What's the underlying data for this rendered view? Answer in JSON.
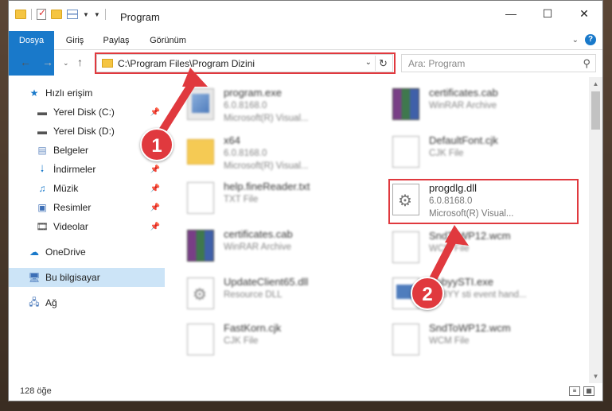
{
  "window": {
    "title": "Program"
  },
  "ribbon": {
    "tabs": [
      "Dosya",
      "Giriş",
      "Paylaş",
      "Görünüm"
    ]
  },
  "address": {
    "path": "C:\\Program Files\\Program Dizini"
  },
  "search": {
    "placeholder": "Ara: Program"
  },
  "sidebar": {
    "items": [
      {
        "label": "Hızlı erişim",
        "icon": "star-icon"
      },
      {
        "label": "Yerel Disk (C:)",
        "icon": "drive-icon",
        "pinned": true
      },
      {
        "label": "Yerel Disk (D:)",
        "icon": "drive-icon"
      },
      {
        "label": "Belgeler",
        "icon": "documents-icon",
        "pinned": true
      },
      {
        "label": "İndirmeler",
        "icon": "download-icon",
        "pinned": true
      },
      {
        "label": "Müzik",
        "icon": "music-icon",
        "pinned": true
      },
      {
        "label": "Resimler",
        "icon": "pictures-icon",
        "pinned": true
      },
      {
        "label": "Videolar",
        "icon": "video-icon",
        "pinned": true
      },
      {
        "label": "OneDrive",
        "icon": "cloud-icon"
      },
      {
        "label": "Bu bilgisayar",
        "icon": "computer-icon",
        "selected": true
      },
      {
        "label": "Ağ",
        "icon": "network-icon"
      }
    ]
  },
  "files": [
    {
      "name": "program.exe",
      "line1": "6.0.8168.0",
      "line2": "Microsoft(R) Visual...",
      "icon": "exe"
    },
    {
      "name": "certificates.cab",
      "line1": "WinRAR Archive",
      "line2": "",
      "icon": "rar"
    },
    {
      "name": "x64",
      "line1": "6.0.8168.0",
      "line2": "Microsoft(R) Visual...",
      "icon": "folder"
    },
    {
      "name": "DefaultFont.cjk",
      "line1": "CJK File",
      "line2": "",
      "icon": "doc"
    },
    {
      "name": "help.fineReader.txt",
      "line1": "TXT File",
      "line2": "",
      "icon": "doc"
    },
    {
      "name": "progdlg.dll",
      "line1": "6.0.8168.0",
      "line2": "Microsoft(R) Visual...",
      "icon": "dll"
    },
    {
      "name": "certificates.cab",
      "line1": "WinRAR Archive",
      "line2": "",
      "icon": "rar"
    },
    {
      "name": "SndToWP12.wcm",
      "line1": "WCM File",
      "line2": "",
      "icon": "doc"
    },
    {
      "name": "UpdateClient65.dll",
      "line1": "Resource DLL",
      "line2": "",
      "icon": "dll"
    },
    {
      "name": "AbbyySTI.exe",
      "line1": "ABBYY sti event hand...",
      "line2": "",
      "icon": "app"
    },
    {
      "name": "FastKorn.cjk",
      "line1": "CJK File",
      "line2": "",
      "icon": "doc"
    },
    {
      "name": "SndToWP12.wcm",
      "line1": "WCM File",
      "line2": "",
      "icon": "doc"
    }
  ],
  "annotations": [
    "1",
    "2"
  ],
  "status": {
    "count": "128 öğe"
  },
  "colors": {
    "accent": "#1979ca",
    "highlight": "#e0393e",
    "selected": "#cce4f7"
  }
}
